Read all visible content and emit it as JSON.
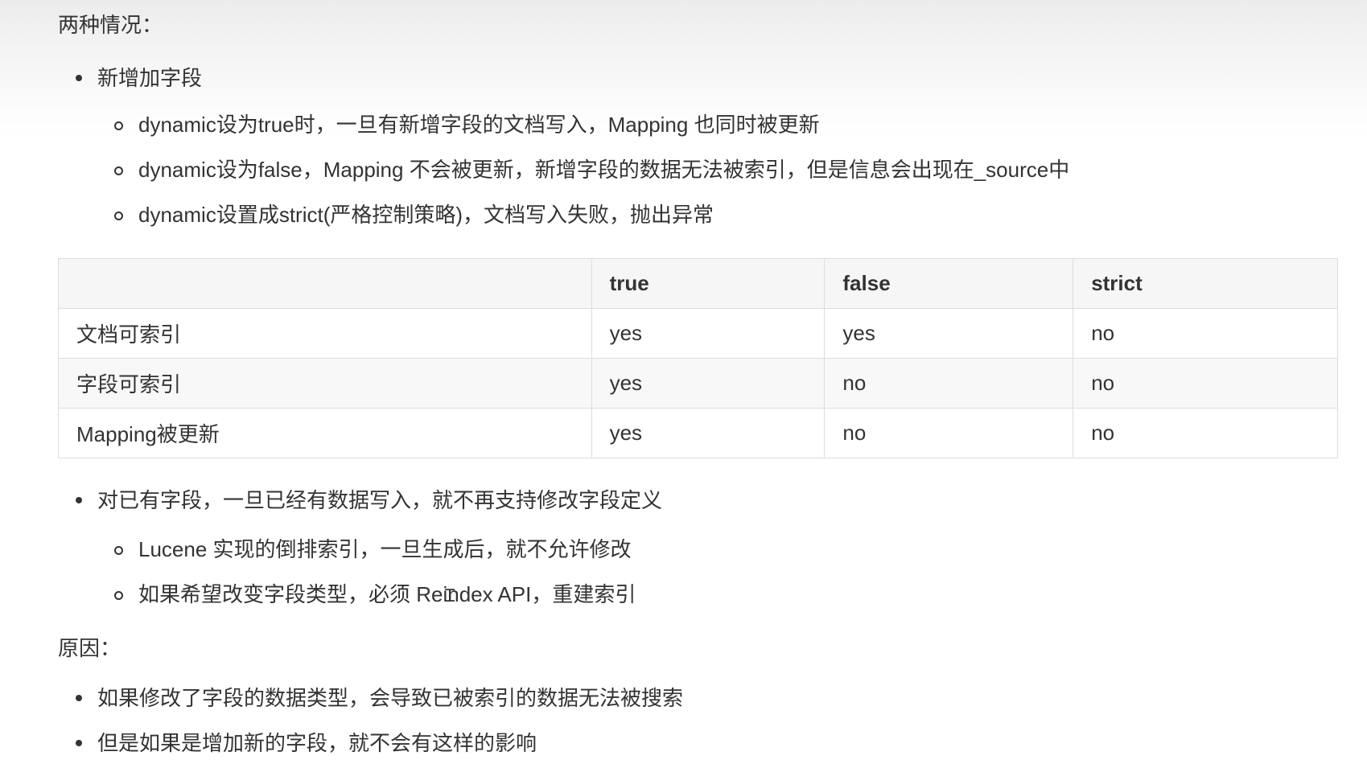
{
  "heading_situations": "两种情况：",
  "new_field": {
    "label": "新增加字段",
    "items": [
      "dynamic设为true时，一旦有新增字段的文档写入，Mapping 也同时被更新",
      "dynamic设为false，Mapping 不会被更新，新增字段的数据无法被索引，但是信息会出现在_source中",
      "dynamic设置成strict(严格控制策略)，文档写入失败，抛出异常"
    ]
  },
  "table": {
    "headers": [
      "",
      "true",
      "false",
      "strict"
    ],
    "rows": [
      [
        "文档可索引",
        "yes",
        "yes",
        "no"
      ],
      [
        "字段可索引",
        "yes",
        "no",
        "no"
      ],
      [
        "Mapping被更新",
        "yes",
        "no",
        "no"
      ]
    ]
  },
  "existing_field": {
    "label": "对已有字段，一旦已经有数据写入，就不再支持修改字段定义",
    "items": [
      "Lucene 实现的倒排索引，一旦生成后，就不允许修改",
      "如果希望改变字段类型，必须 Reindex API，重建索引"
    ]
  },
  "heading_reason": "原因：",
  "reasons": [
    "如果修改了字段的数据类型，会导致已被索引的数据无法被搜索",
    "但是如果是增加新的字段，就不会有这样的影响"
  ]
}
